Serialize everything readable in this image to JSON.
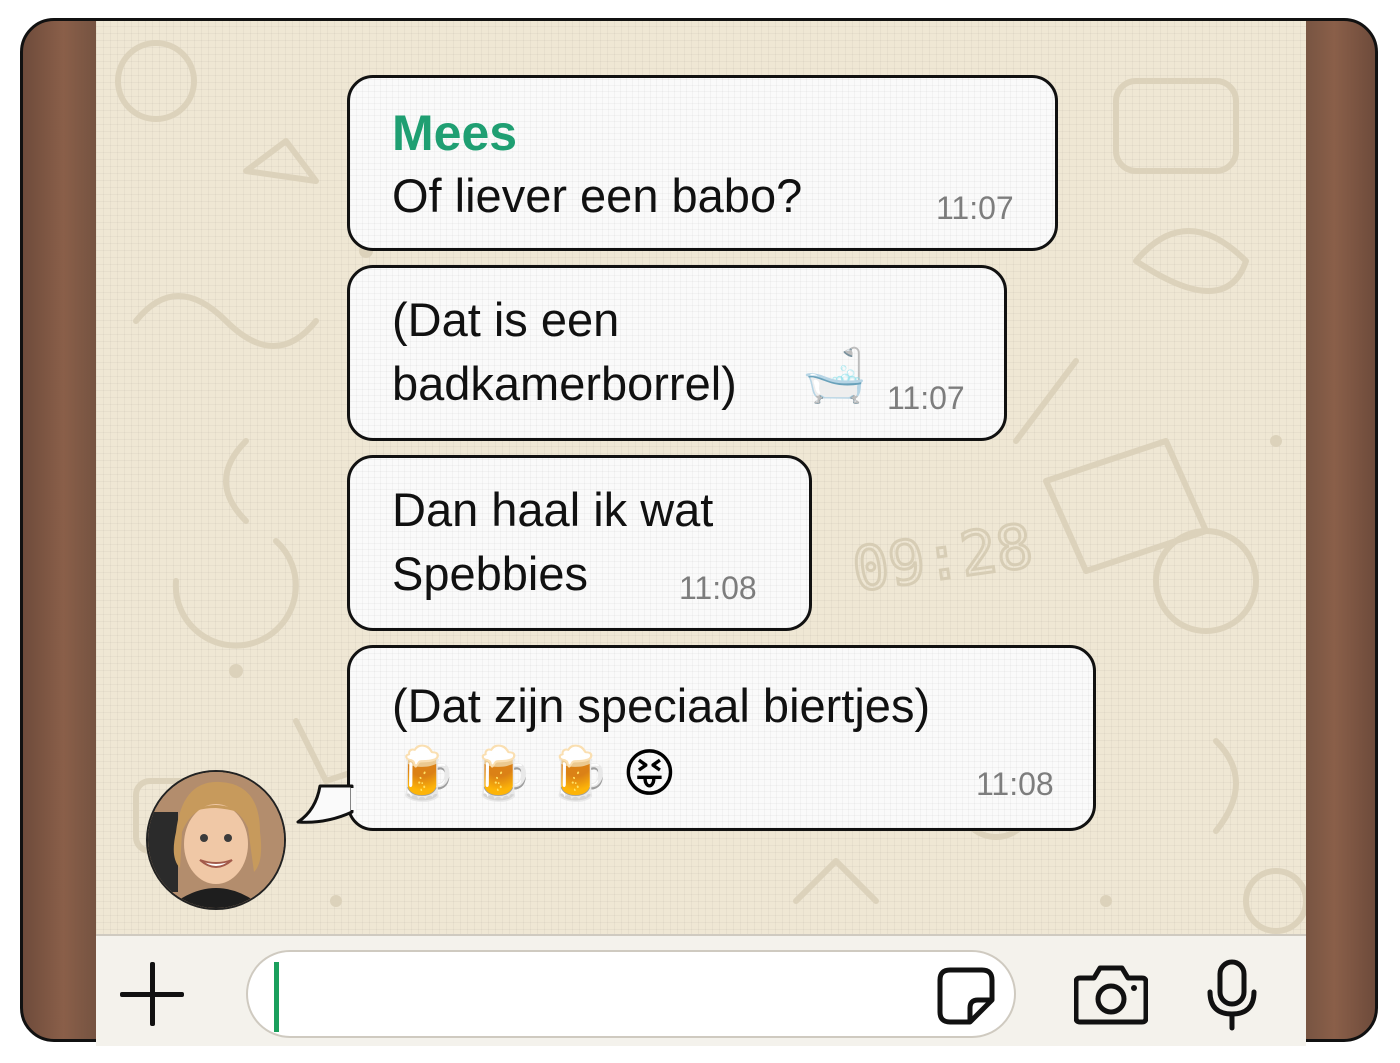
{
  "messages": [
    {
      "sender": "Mees",
      "lines": [
        "Of liever een babo?"
      ],
      "emoji": "",
      "time": "11:07"
    },
    {
      "sender": "",
      "lines": [
        "(Dat is een",
        "badkamerborrel)"
      ],
      "emoji": "🛁",
      "time": "11:07"
    },
    {
      "sender": "",
      "lines": [
        "Dan haal ik wat",
        "Spebbies"
      ],
      "emoji": "",
      "time": "11:08"
    },
    {
      "sender": "",
      "lines": [
        "(Dat zijn speciaal biertjes)"
      ],
      "emoji": "🍺🍺🍺😝",
      "time": "11:08"
    }
  ],
  "background_watermark": "09:28",
  "input": {
    "value": ""
  },
  "icons": {
    "attach": "plus-icon",
    "sticker": "sticker-icon",
    "camera": "camera-icon",
    "voice": "microphone-icon",
    "avatar": "avatar"
  },
  "colors": {
    "sender_name": "#1f9f72",
    "caret": "#1a9f5c",
    "chat_background": "#efe7d4"
  }
}
